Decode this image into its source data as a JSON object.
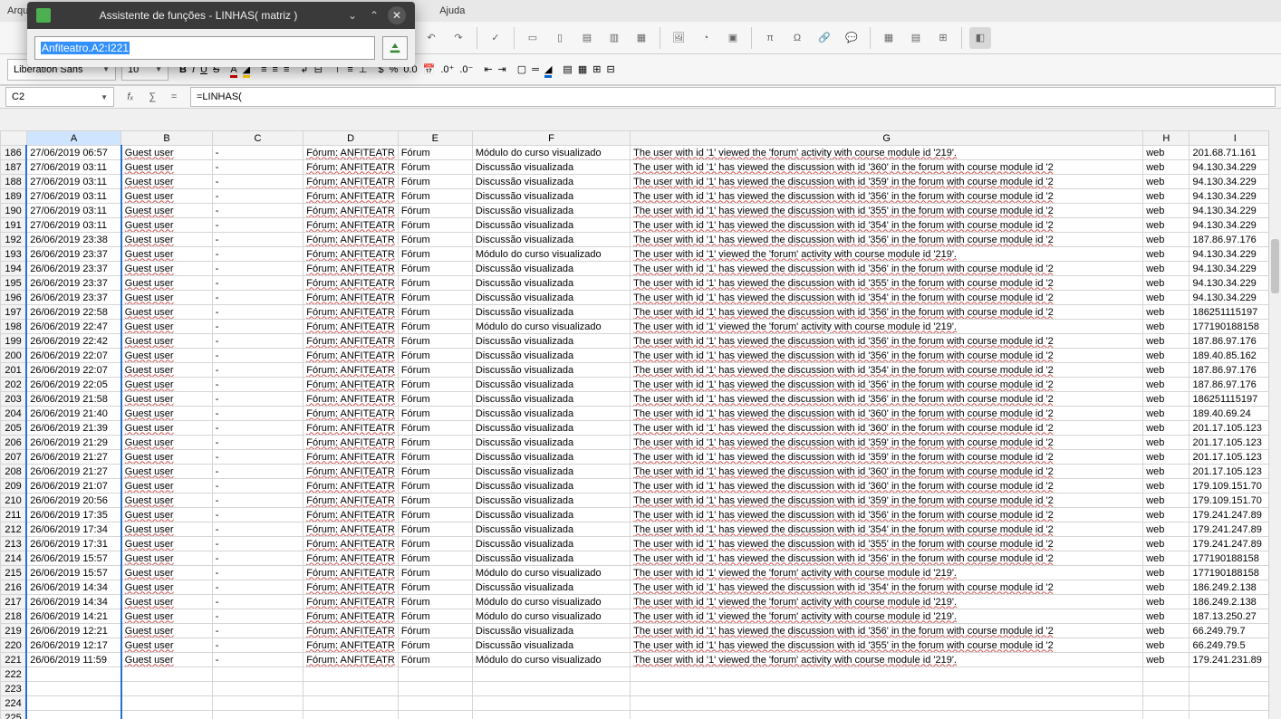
{
  "menu": {
    "arquivo": "Arquiv",
    "ajuda": "Ajuda"
  },
  "assistant": {
    "title": "Assistente de funções - LINHAS( matriz )",
    "input_value": "Anfiteatro.A2:I221"
  },
  "font": {
    "name": "Liberation Sans",
    "size": "10"
  },
  "cell_ref": "C2",
  "formula": "=LINHAS(",
  "columns": [
    "A",
    "B",
    "C",
    "D",
    "E",
    "F",
    "G",
    "H",
    "I"
  ],
  "rows": [
    {
      "n": 186,
      "a": "27/06/2019 06:57",
      "b": "Guest user",
      "c": "-",
      "d": "Fórum: ANFITEATR",
      "e": "Fórum",
      "f": "Módulo do curso visualizado",
      "g": "The user with id '1' viewed the 'forum' activity with course module id '219'.",
      "h": "web",
      "i": "201.68.71.161"
    },
    {
      "n": 187,
      "a": "27/06/2019 03:11",
      "b": "Guest user",
      "c": "-",
      "d": "Fórum: ANFITEATR",
      "e": "Fórum",
      "f": "Discussão visualizada",
      "g": "The user with id '1' has viewed the discussion with id '360' in the forum with course module id '2",
      "h": "web",
      "i": "94.130.34.229"
    },
    {
      "n": 188,
      "a": "27/06/2019 03:11",
      "b": "Guest user",
      "c": "-",
      "d": "Fórum: ANFITEATR",
      "e": "Fórum",
      "f": "Discussão visualizada",
      "g": "The user with id '1' has viewed the discussion with id '359' in the forum with course module id '2",
      "h": "web",
      "i": "94.130.34.229"
    },
    {
      "n": 189,
      "a": "27/06/2019 03:11",
      "b": "Guest user",
      "c": "-",
      "d": "Fórum: ANFITEATR",
      "e": "Fórum",
      "f": "Discussão visualizada",
      "g": "The user with id '1' has viewed the discussion with id '356' in the forum with course module id '2",
      "h": "web",
      "i": "94.130.34.229"
    },
    {
      "n": 190,
      "a": "27/06/2019 03:11",
      "b": "Guest user",
      "c": "-",
      "d": "Fórum: ANFITEATR",
      "e": "Fórum",
      "f": "Discussão visualizada",
      "g": "The user with id '1' has viewed the discussion with id '355' in the forum with course module id '2",
      "h": "web",
      "i": "94.130.34.229"
    },
    {
      "n": 191,
      "a": "27/06/2019 03:11",
      "b": "Guest user",
      "c": "-",
      "d": "Fórum: ANFITEATR",
      "e": "Fórum",
      "f": "Discussão visualizada",
      "g": "The user with id '1' has viewed the discussion with id '354' in the forum with course module id '2",
      "h": "web",
      "i": "94.130.34.229"
    },
    {
      "n": 192,
      "a": "26/06/2019 23:38",
      "b": "Guest user",
      "c": "-",
      "d": "Fórum: ANFITEATR",
      "e": "Fórum",
      "f": "Discussão visualizada",
      "g": "The user with id '1' has viewed the discussion with id '356' in the forum with course module id '2",
      "h": "web",
      "i": "187.86.97.176"
    },
    {
      "n": 193,
      "a": "26/06/2019 23:37",
      "b": "Guest user",
      "c": "-",
      "d": "Fórum: ANFITEATR",
      "e": "Fórum",
      "f": "Módulo do curso visualizado",
      "g": "The user with id '1' viewed the 'forum' activity with course module id '219'.",
      "h": "web",
      "i": "94.130.34.229"
    },
    {
      "n": 194,
      "a": "26/06/2019 23:37",
      "b": "Guest user",
      "c": "-",
      "d": "Fórum: ANFITEATR",
      "e": "Fórum",
      "f": "Discussão visualizada",
      "g": "The user with id '1' has viewed the discussion with id '356' in the forum with course module id '2",
      "h": "web",
      "i": "94.130.34.229"
    },
    {
      "n": 195,
      "a": "26/06/2019 23:37",
      "b": "Guest user",
      "c": "-",
      "d": "Fórum: ANFITEATR",
      "e": "Fórum",
      "f": "Discussão visualizada",
      "g": "The user with id '1' has viewed the discussion with id '355' in the forum with course module id '2",
      "h": "web",
      "i": "94.130.34.229"
    },
    {
      "n": 196,
      "a": "26/06/2019 23:37",
      "b": "Guest user",
      "c": "-",
      "d": "Fórum: ANFITEATR",
      "e": "Fórum",
      "f": "Discussão visualizada",
      "g": "The user with id '1' has viewed the discussion with id '354' in the forum with course module id '2",
      "h": "web",
      "i": "94.130.34.229"
    },
    {
      "n": 197,
      "a": "26/06/2019 22:58",
      "b": "Guest user",
      "c": "-",
      "d": "Fórum: ANFITEATR",
      "e": "Fórum",
      "f": "Discussão visualizada",
      "g": "The user with id '1' has viewed the discussion with id '356' in the forum with course module id '2",
      "h": "web",
      "i": "186251115197"
    },
    {
      "n": 198,
      "a": "26/06/2019 22:47",
      "b": "Guest user",
      "c": "-",
      "d": "Fórum: ANFITEATR",
      "e": "Fórum",
      "f": "Módulo do curso visualizado",
      "g": "The user with id '1' viewed the 'forum' activity with course module id '219'.",
      "h": "web",
      "i": "177190188158"
    },
    {
      "n": 199,
      "a": "26/06/2019 22:42",
      "b": "Guest user",
      "c": "-",
      "d": "Fórum: ANFITEATR",
      "e": "Fórum",
      "f": "Discussão visualizada",
      "g": "The user with id '1' has viewed the discussion with id '356' in the forum with course module id '2",
      "h": "web",
      "i": "187.86.97.176"
    },
    {
      "n": 200,
      "a": "26/06/2019 22:07",
      "b": "Guest user",
      "c": "-",
      "d": "Fórum: ANFITEATR",
      "e": "Fórum",
      "f": "Discussão visualizada",
      "g": "The user with id '1' has viewed the discussion with id '356' in the forum with course module id '2",
      "h": "web",
      "i": "189.40.85.162"
    },
    {
      "n": 201,
      "a": "26/06/2019 22:07",
      "b": "Guest user",
      "c": "-",
      "d": "Fórum: ANFITEATR",
      "e": "Fórum",
      "f": "Discussão visualizada",
      "g": "The user with id '1' has viewed the discussion with id '354' in the forum with course module id '2",
      "h": "web",
      "i": "187.86.97.176"
    },
    {
      "n": 202,
      "a": "26/06/2019 22:05",
      "b": "Guest user",
      "c": "-",
      "d": "Fórum: ANFITEATR",
      "e": "Fórum",
      "f": "Discussão visualizada",
      "g": "The user with id '1' has viewed the discussion with id '356' in the forum with course module id '2",
      "h": "web",
      "i": "187.86.97.176"
    },
    {
      "n": 203,
      "a": "26/06/2019 21:58",
      "b": "Guest user",
      "c": "-",
      "d": "Fórum: ANFITEATR",
      "e": "Fórum",
      "f": "Discussão visualizada",
      "g": "The user with id '1' has viewed the discussion with id '356' in the forum with course module id '2",
      "h": "web",
      "i": "186251115197"
    },
    {
      "n": 204,
      "a": "26/06/2019 21:40",
      "b": "Guest user",
      "c": "-",
      "d": "Fórum: ANFITEATR",
      "e": "Fórum",
      "f": "Discussão visualizada",
      "g": "The user with id '1' has viewed the discussion with id '360' in the forum with course module id '2",
      "h": "web",
      "i": "189.40.69.24"
    },
    {
      "n": 205,
      "a": "26/06/2019 21:39",
      "b": "Guest user",
      "c": "-",
      "d": "Fórum: ANFITEATR",
      "e": "Fórum",
      "f": "Discussão visualizada",
      "g": "The user with id '1' has viewed the discussion with id '360' in the forum with course module id '2",
      "h": "web",
      "i": "201.17.105.123"
    },
    {
      "n": 206,
      "a": "26/06/2019 21:29",
      "b": "Guest user",
      "c": "-",
      "d": "Fórum: ANFITEATR",
      "e": "Fórum",
      "f": "Discussão visualizada",
      "g": "The user with id '1' has viewed the discussion with id '359' in the forum with course module id '2",
      "h": "web",
      "i": "201.17.105.123"
    },
    {
      "n": 207,
      "a": "26/06/2019 21:27",
      "b": "Guest user",
      "c": "-",
      "d": "Fórum: ANFITEATR",
      "e": "Fórum",
      "f": "Discussão visualizada",
      "g": "The user with id '1' has viewed the discussion with id '359' in the forum with course module id '2",
      "h": "web",
      "i": "201.17.105.123"
    },
    {
      "n": 208,
      "a": "26/06/2019 21:27",
      "b": "Guest user",
      "c": "-",
      "d": "Fórum: ANFITEATR",
      "e": "Fórum",
      "f": "Discussão visualizada",
      "g": "The user with id '1' has viewed the discussion with id '360' in the forum with course module id '2",
      "h": "web",
      "i": "201.17.105.123"
    },
    {
      "n": 209,
      "a": "26/06/2019 21:07",
      "b": "Guest user",
      "c": "-",
      "d": "Fórum: ANFITEATR",
      "e": "Fórum",
      "f": "Discussão visualizada",
      "g": "The user with id '1' has viewed the discussion with id '360' in the forum with course module id '2",
      "h": "web",
      "i": "179.109.151.70"
    },
    {
      "n": 210,
      "a": "26/06/2019 20:56",
      "b": "Guest user",
      "c": "-",
      "d": "Fórum: ANFITEATR",
      "e": "Fórum",
      "f": "Discussão visualizada",
      "g": "The user with id '1' has viewed the discussion with id '359' in the forum with course module id '2",
      "h": "web",
      "i": "179.109.151.70"
    },
    {
      "n": 211,
      "a": "26/06/2019 17:35",
      "b": "Guest user",
      "c": "-",
      "d": "Fórum: ANFITEATR",
      "e": "Fórum",
      "f": "Discussão visualizada",
      "g": "The user with id '1' has viewed the discussion with id '356' in the forum with course module id '2",
      "h": "web",
      "i": "179.241.247.89"
    },
    {
      "n": 212,
      "a": "26/06/2019 17:34",
      "b": "Guest user",
      "c": "-",
      "d": "Fórum: ANFITEATR",
      "e": "Fórum",
      "f": "Discussão visualizada",
      "g": "The user with id '1' has viewed the discussion with id '354' in the forum with course module id '2",
      "h": "web",
      "i": "179.241.247.89"
    },
    {
      "n": 213,
      "a": "26/06/2019 17:31",
      "b": "Guest user",
      "c": "-",
      "d": "Fórum: ANFITEATR",
      "e": "Fórum",
      "f": "Discussão visualizada",
      "g": "The user with id '1' has viewed the discussion with id '355' in the forum with course module id '2",
      "h": "web",
      "i": "179.241.247.89"
    },
    {
      "n": 214,
      "a": "26/06/2019 15:57",
      "b": "Guest user",
      "c": "-",
      "d": "Fórum: ANFITEATR",
      "e": "Fórum",
      "f": "Discussão visualizada",
      "g": "The user with id '1' has viewed the discussion with id '356' in the forum with course module id '2",
      "h": "web",
      "i": "177190188158"
    },
    {
      "n": 215,
      "a": "26/06/2019 15:57",
      "b": "Guest user",
      "c": "-",
      "d": "Fórum: ANFITEATR",
      "e": "Fórum",
      "f": "Módulo do curso visualizado",
      "g": "The user with id '1' viewed the 'forum' activity with course module id '219'.",
      "h": "web",
      "i": "177190188158"
    },
    {
      "n": 216,
      "a": "26/06/2019 14:34",
      "b": "Guest user",
      "c": "-",
      "d": "Fórum: ANFITEATR",
      "e": "Fórum",
      "f": "Discussão visualizada",
      "g": "The user with id '1' has viewed the discussion with id '354' in the forum with course module id '2",
      "h": "web",
      "i": "186.249.2.138"
    },
    {
      "n": 217,
      "a": "26/06/2019 14:34",
      "b": "Guest user",
      "c": "-",
      "d": "Fórum: ANFITEATR",
      "e": "Fórum",
      "f": "Módulo do curso visualizado",
      "g": "The user with id '1' viewed the 'forum' activity with course module id '219'.",
      "h": "web",
      "i": "186.249.2.138"
    },
    {
      "n": 218,
      "a": "26/06/2019 14:21",
      "b": "Guest user",
      "c": "-",
      "d": "Fórum: ANFITEATR",
      "e": "Fórum",
      "f": "Módulo do curso visualizado",
      "g": "The user with id '1' viewed the 'forum' activity with course module id '219'.",
      "h": "web",
      "i": "187.13.250.27"
    },
    {
      "n": 219,
      "a": "26/06/2019 12:21",
      "b": "Guest user",
      "c": "-",
      "d": "Fórum: ANFITEATR",
      "e": "Fórum",
      "f": "Discussão visualizada",
      "g": "The user with id '1' has viewed the discussion with id '356' in the forum with course module id '2",
      "h": "web",
      "i": "66.249.79.7"
    },
    {
      "n": 220,
      "a": "26/06/2019 12:17",
      "b": "Guest user",
      "c": "-",
      "d": "Fórum: ANFITEATR",
      "e": "Fórum",
      "f": "Discussão visualizada",
      "g": "The user with id '1' has viewed the discussion with id '355' in the forum with course module id '2",
      "h": "web",
      "i": "66.249.79.5"
    },
    {
      "n": 221,
      "a": "26/06/2019 11:59",
      "b": "Guest user",
      "c": "-",
      "d": "Fórum: ANFITEATR",
      "e": "Fórum",
      "f": "Módulo do curso visualizado",
      "g": "The user with id '1' viewed the 'forum' activity with course module id '219'.",
      "h": "web",
      "i": "179.241.231.89"
    }
  ],
  "empty_rows": [
    222,
    223,
    224,
    225
  ]
}
